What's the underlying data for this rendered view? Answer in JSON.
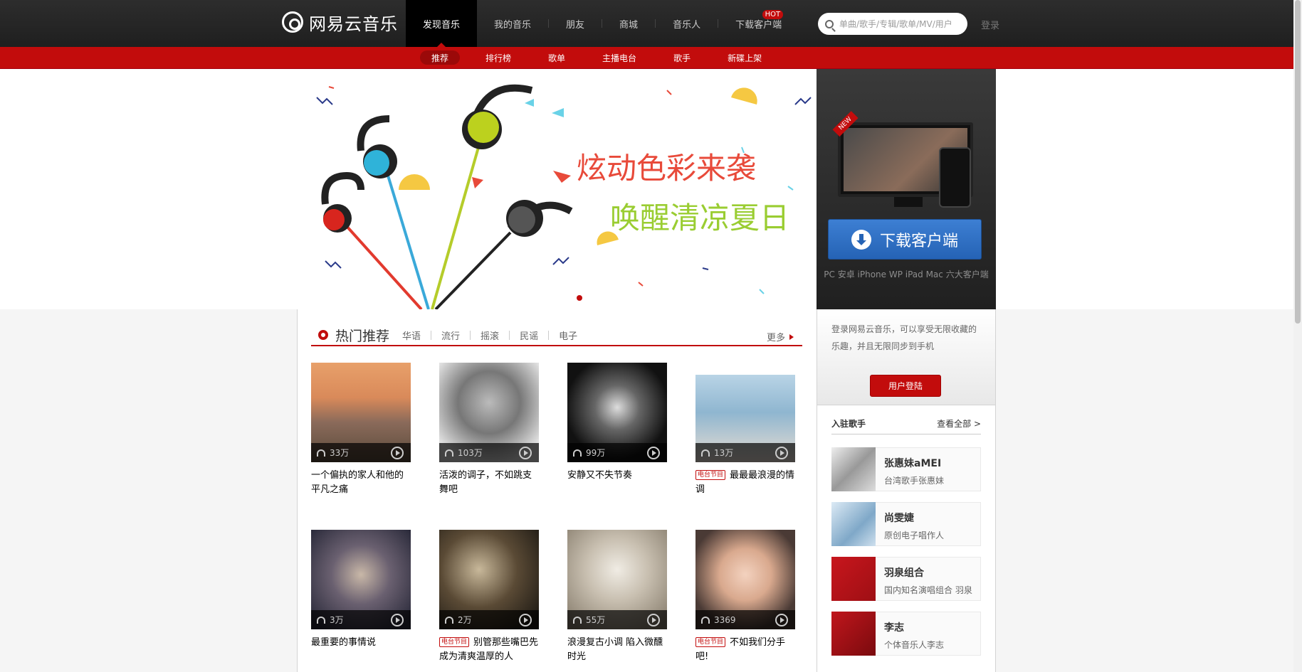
{
  "header": {
    "logo_text": "网易云音乐",
    "nav": [
      {
        "label": "发现音乐",
        "active": true
      },
      {
        "label": "我的音乐",
        "active": false
      },
      {
        "label": "朋友",
        "active": false
      },
      {
        "label": "商城",
        "active": false
      },
      {
        "label": "音乐人",
        "active": false
      },
      {
        "label": "下载客户端",
        "active": false,
        "badge": "HOT"
      }
    ],
    "search_placeholder": "单曲/歌手/专辑/歌单/MV/用户",
    "login": "登录"
  },
  "subnav": [
    "推荐",
    "排行榜",
    "歌单",
    "主播电台",
    "歌手",
    "新碟上架"
  ],
  "banner": {
    "line1": "炫动色彩来袭",
    "line2": "唤醒清凉夏日"
  },
  "download": {
    "new_tag": "NEW",
    "button": "下载客户端",
    "caption": "PC 安卓 iPhone WP iPad Mac 六大客户端"
  },
  "hot": {
    "title": "热门推荐",
    "tags": [
      "华语",
      "流行",
      "摇滚",
      "民谣",
      "电子"
    ],
    "more": "更多",
    "radio_badge": "电台节目",
    "playlists": [
      {
        "plays": "33万",
        "title": "一个偏执的家人和他的平凡之痛",
        "radio": false
      },
      {
        "plays": "103万",
        "title": "活泼的调子，不如跳支舞吧",
        "radio": false
      },
      {
        "plays": "99万",
        "title": "安静又不失节奏",
        "radio": false
      },
      {
        "plays": "13万",
        "title": "最最最浪漫的情调",
        "radio": true
      },
      {
        "plays": "3万",
        "title": "最重要的事情说",
        "radio": false
      },
      {
        "plays": "2万",
        "title": "别管那些嘴巴先成为清爽温厚的人",
        "radio": true
      },
      {
        "plays": "55万",
        "title": "浪漫复古小调 陷入微醺时光",
        "radio": false
      },
      {
        "plays": "3369",
        "title": "不如我们分手吧!",
        "radio": true
      }
    ]
  },
  "sidebar": {
    "login_text": "登录网易云音乐，可以享受无限收藏的乐趣，并且无限同步到手机",
    "login_button": "用户登陆",
    "singers_title": "入驻歌手",
    "view_all": "查看全部 >",
    "singers": [
      {
        "name": "张惠妹aMEI",
        "desc": "台湾歌手张惠妹"
      },
      {
        "name": "尚雯婕",
        "desc": "原创电子唱作人"
      },
      {
        "name": "羽泉组合",
        "desc": "国内知名演唱组合 羽泉"
      },
      {
        "name": "李志",
        "desc": "个体音乐人李志"
      }
    ]
  }
}
